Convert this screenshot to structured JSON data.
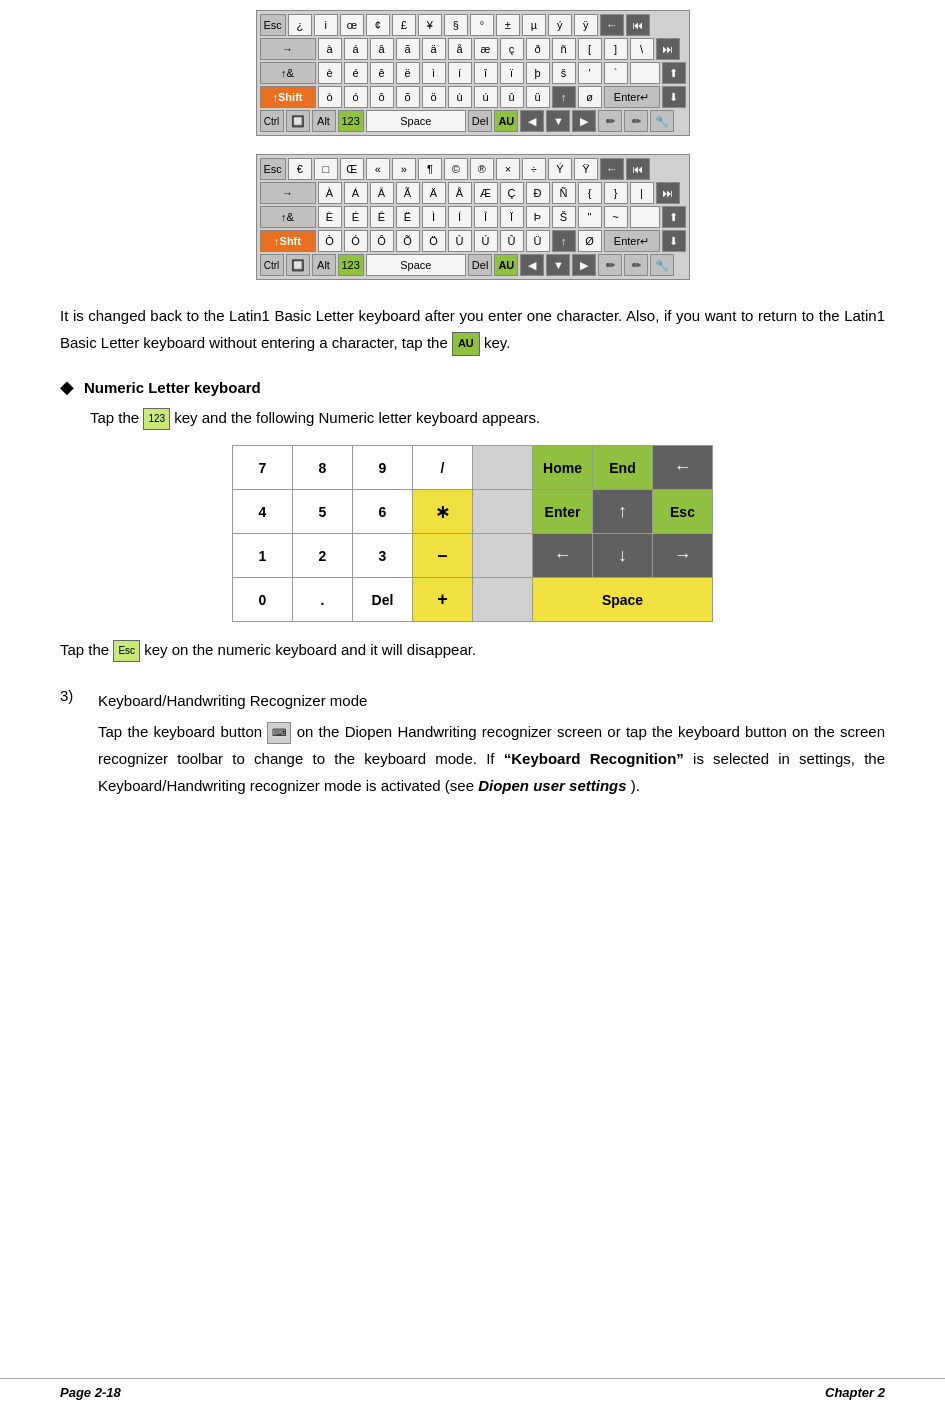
{
  "keyboards": {
    "kb1_description": "Latin1 Shift keyboard with special characters",
    "kb2_description": "Latin1 Shift keyboard alternate view"
  },
  "text": {
    "para1": "It is changed back to the Latin1 Basic Letter keyboard after you enter one character. Also, if you want to return to the Latin1 Basic Letter keyboard without entering a character, tap the",
    "para1_key": "AU",
    "para1_end": "key.",
    "bullet_title": "Numeric Letter keyboard",
    "bullet_text_pre": "Tap the",
    "bullet_key": "123",
    "bullet_text_post": "key and the following Numeric letter keyboard appears.",
    "tap_esc_pre": "Tap the",
    "tap_esc_key": "Esc",
    "tap_esc_post": "key on the numeric keyboard and it will disappear.",
    "section3_num": "3)",
    "section3_title": "Keyboard/Handwriting Recognizer mode",
    "section3_para": "Tap the keyboard button",
    "section3_para2": "on the Diopen Handwriting recognizer screen or tap the keyboard button on the screen recognizer toolbar to change to the keyboard mode. If",
    "section3_bold": "“Keyboard Recognition”",
    "section3_para3": "is selected in settings, the Keyboard/Handwriting recognizer mode is activated (see",
    "section3_italic_bold": "Diopen user settings",
    "section3_end": ")."
  },
  "numkb": {
    "rows": [
      [
        "7",
        "8",
        "9",
        "/",
        "",
        "Home",
        "End",
        "←"
      ],
      [
        "4",
        "5",
        "6",
        "∗",
        "",
        "Enter",
        "↑",
        "Esc"
      ],
      [
        "1",
        "2",
        "3",
        "–",
        "",
        "←",
        "↓",
        "→"
      ],
      [
        "0",
        ".",
        "Del",
        "+",
        "",
        "Space",
        "",
        ""
      ]
    ]
  },
  "footer": {
    "left": "Page 2-18",
    "right": "Chapter 2"
  }
}
